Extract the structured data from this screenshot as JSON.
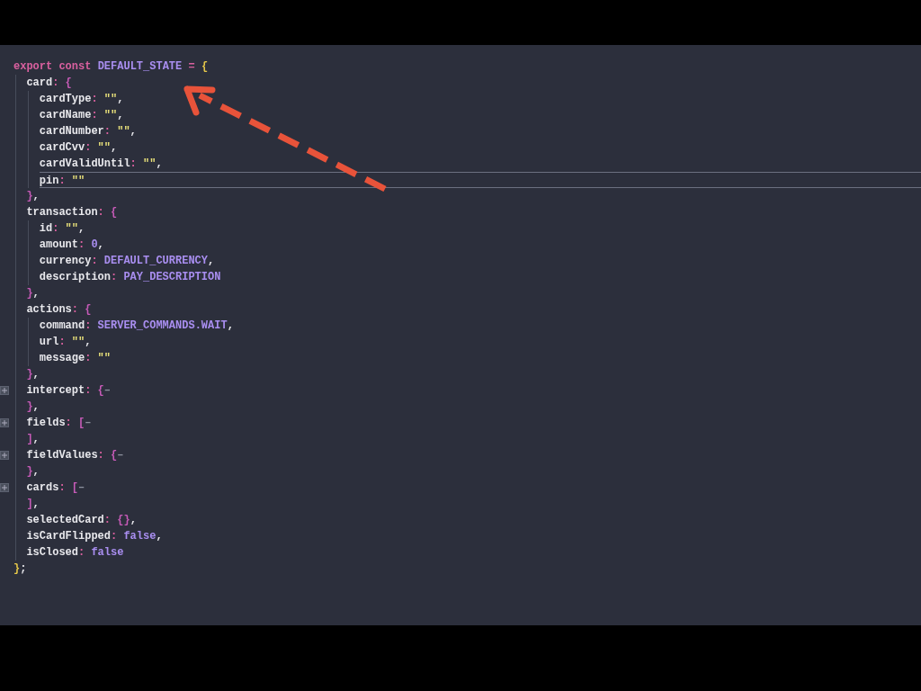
{
  "editor": {
    "lines": [
      {
        "tokens": [
          {
            "kind": "keyword",
            "text": "export"
          },
          {
            "kind": "keyword",
            "text": " const "
          },
          {
            "kind": "constant",
            "text": "DEFAULT_STATE"
          },
          {
            "kind": "operator",
            "text": " = "
          },
          {
            "kind": "brace1",
            "text": "{"
          }
        ],
        "folded": false,
        "current": false,
        "children": [
          {
            "tokens": [
              {
                "kind": "text",
                "text": "card"
              },
              {
                "kind": "operator",
                "text": ": "
              },
              {
                "kind": "brace2",
                "text": "{"
              }
            ],
            "folded": false,
            "current": false,
            "children": [
              {
                "tokens": [
                  {
                    "kind": "text",
                    "text": "cardType"
                  },
                  {
                    "kind": "operator",
                    "text": ": "
                  },
                  {
                    "kind": "string",
                    "text": "\"\""
                  },
                  {
                    "kind": "text",
                    "text": ","
                  }
                ],
                "folded": false,
                "current": false
              },
              {
                "tokens": [
                  {
                    "kind": "text",
                    "text": "cardName"
                  },
                  {
                    "kind": "operator",
                    "text": ": "
                  },
                  {
                    "kind": "string",
                    "text": "\"\""
                  },
                  {
                    "kind": "text",
                    "text": ","
                  }
                ],
                "folded": false,
                "current": false
              },
              {
                "tokens": [
                  {
                    "kind": "text",
                    "text": "cardNumber"
                  },
                  {
                    "kind": "operator",
                    "text": ": "
                  },
                  {
                    "kind": "string",
                    "text": "\"\""
                  },
                  {
                    "kind": "text",
                    "text": ","
                  }
                ],
                "folded": false,
                "current": false
              },
              {
                "tokens": [
                  {
                    "kind": "text",
                    "text": "cardCvv"
                  },
                  {
                    "kind": "operator",
                    "text": ": "
                  },
                  {
                    "kind": "string",
                    "text": "\"\""
                  },
                  {
                    "kind": "text",
                    "text": ","
                  }
                ],
                "folded": false,
                "current": false
              },
              {
                "tokens": [
                  {
                    "kind": "text",
                    "text": "cardValidUntil"
                  },
                  {
                    "kind": "operator",
                    "text": ": "
                  },
                  {
                    "kind": "string",
                    "text": "\"\""
                  },
                  {
                    "kind": "text",
                    "text": ","
                  }
                ],
                "folded": false,
                "current": false
              },
              {
                "tokens": [
                  {
                    "kind": "text",
                    "text": "pin"
                  },
                  {
                    "kind": "operator",
                    "text": ": "
                  },
                  {
                    "kind": "string",
                    "text": "\"\""
                  }
                ],
                "folded": false,
                "current": true
              }
            ]
          },
          {
            "tokens": [
              {
                "kind": "brace2",
                "text": "}"
              },
              {
                "kind": "text",
                "text": ","
              }
            ],
            "folded": false,
            "current": false
          },
          {
            "tokens": [
              {
                "kind": "text",
                "text": "transaction"
              },
              {
                "kind": "operator",
                "text": ": "
              },
              {
                "kind": "brace2",
                "text": "{"
              }
            ],
            "folded": false,
            "current": false,
            "children": [
              {
                "tokens": [
                  {
                    "kind": "text",
                    "text": "id"
                  },
                  {
                    "kind": "operator",
                    "text": ": "
                  },
                  {
                    "kind": "string",
                    "text": "\"\""
                  },
                  {
                    "kind": "text",
                    "text": ","
                  }
                ],
                "folded": false,
                "current": false
              },
              {
                "tokens": [
                  {
                    "kind": "text",
                    "text": "amount"
                  },
                  {
                    "kind": "operator",
                    "text": ": "
                  },
                  {
                    "kind": "constant",
                    "text": "0"
                  },
                  {
                    "kind": "text",
                    "text": ","
                  }
                ],
                "folded": false,
                "current": false
              },
              {
                "tokens": [
                  {
                    "kind": "text",
                    "text": "currency"
                  },
                  {
                    "kind": "operator",
                    "text": ": "
                  },
                  {
                    "kind": "constant",
                    "text": "DEFAULT_CURRENCY"
                  },
                  {
                    "kind": "text",
                    "text": ","
                  }
                ],
                "folded": false,
                "current": false
              },
              {
                "tokens": [
                  {
                    "kind": "text",
                    "text": "description"
                  },
                  {
                    "kind": "operator",
                    "text": ": "
                  },
                  {
                    "kind": "constant",
                    "text": "PAY_DESCRIPTION"
                  }
                ],
                "folded": false,
                "current": false
              }
            ]
          },
          {
            "tokens": [
              {
                "kind": "brace2",
                "text": "}"
              },
              {
                "kind": "text",
                "text": ","
              }
            ],
            "folded": false,
            "current": false
          },
          {
            "tokens": [
              {
                "kind": "text",
                "text": "actions"
              },
              {
                "kind": "operator",
                "text": ": "
              },
              {
                "kind": "brace2",
                "text": "{"
              }
            ],
            "folded": false,
            "current": false,
            "children": [
              {
                "tokens": [
                  {
                    "kind": "text",
                    "text": "command"
                  },
                  {
                    "kind": "operator",
                    "text": ": "
                  },
                  {
                    "kind": "constant",
                    "text": "SERVER_COMMANDS.WAIT"
                  },
                  {
                    "kind": "text",
                    "text": ","
                  }
                ],
                "folded": false,
                "current": false
              },
              {
                "tokens": [
                  {
                    "kind": "text",
                    "text": "url"
                  },
                  {
                    "kind": "operator",
                    "text": ": "
                  },
                  {
                    "kind": "string",
                    "text": "\"\""
                  },
                  {
                    "kind": "text",
                    "text": ","
                  }
                ],
                "folded": false,
                "current": false
              },
              {
                "tokens": [
                  {
                    "kind": "text",
                    "text": "message"
                  },
                  {
                    "kind": "operator",
                    "text": ": "
                  },
                  {
                    "kind": "string",
                    "text": "\"\""
                  }
                ],
                "folded": false,
                "current": false
              }
            ]
          },
          {
            "tokens": [
              {
                "kind": "brace2",
                "text": "}"
              },
              {
                "kind": "text",
                "text": ","
              }
            ],
            "folded": false,
            "current": false
          },
          {
            "tokens": [
              {
                "kind": "text",
                "text": "intercept"
              },
              {
                "kind": "operator",
                "text": ": "
              },
              {
                "kind": "brace2",
                "text": "{"
              },
              {
                "kind": "ellipsis",
                "text": "–"
              }
            ],
            "folded": true,
            "current": false
          },
          {
            "tokens": [
              {
                "kind": "brace2",
                "text": "}"
              },
              {
                "kind": "text",
                "text": ","
              }
            ],
            "folded": false,
            "current": false
          },
          {
            "tokens": [
              {
                "kind": "text",
                "text": "fields"
              },
              {
                "kind": "operator",
                "text": ": "
              },
              {
                "kind": "brace2",
                "text": "["
              },
              {
                "kind": "ellipsis",
                "text": "–"
              }
            ],
            "folded": true,
            "current": false
          },
          {
            "tokens": [
              {
                "kind": "brace2",
                "text": "]"
              },
              {
                "kind": "text",
                "text": ","
              }
            ],
            "folded": false,
            "current": false
          },
          {
            "tokens": [
              {
                "kind": "text",
                "text": "fieldValues"
              },
              {
                "kind": "operator",
                "text": ": "
              },
              {
                "kind": "brace2",
                "text": "{"
              },
              {
                "kind": "ellipsis",
                "text": "–"
              }
            ],
            "folded": true,
            "current": false
          },
          {
            "tokens": [
              {
                "kind": "brace2",
                "text": "}"
              },
              {
                "kind": "text",
                "text": ","
              }
            ],
            "folded": false,
            "current": false
          },
          {
            "tokens": [
              {
                "kind": "text",
                "text": "cards"
              },
              {
                "kind": "operator",
                "text": ": "
              },
              {
                "kind": "brace2",
                "text": "["
              },
              {
                "kind": "ellipsis",
                "text": "–"
              }
            ],
            "folded": true,
            "current": false
          },
          {
            "tokens": [
              {
                "kind": "brace2",
                "text": "]"
              },
              {
                "kind": "text",
                "text": ","
              }
            ],
            "folded": false,
            "current": false
          },
          {
            "tokens": [
              {
                "kind": "text",
                "text": "selectedCard"
              },
              {
                "kind": "operator",
                "text": ": "
              },
              {
                "kind": "brace2",
                "text": "{}"
              },
              {
                "kind": "text",
                "text": ","
              }
            ],
            "folded": false,
            "current": false
          },
          {
            "tokens": [
              {
                "kind": "text",
                "text": "isCardFlipped"
              },
              {
                "kind": "operator",
                "text": ": "
              },
              {
                "kind": "constant",
                "text": "false"
              },
              {
                "kind": "text",
                "text": ","
              }
            ],
            "folded": false,
            "current": false
          },
          {
            "tokens": [
              {
                "kind": "text",
                "text": "isClosed"
              },
              {
                "kind": "operator",
                "text": ": "
              },
              {
                "kind": "constant",
                "text": "false"
              }
            ],
            "folded": false,
            "current": false
          }
        ]
      },
      {
        "tokens": [
          {
            "kind": "brace1",
            "text": "}"
          },
          {
            "kind": "text",
            "text": ";"
          }
        ],
        "folded": false,
        "current": false
      }
    ]
  }
}
